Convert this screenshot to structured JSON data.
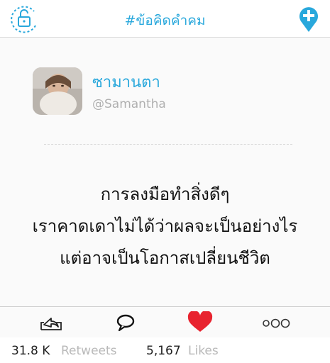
{
  "header": {
    "title": "#ข้อคิดคำคม",
    "lock_icon": "lock-icon",
    "add_icon": "add-location-icon",
    "accent_color": "#29a8dc"
  },
  "profile": {
    "display_name": "ซามานตา",
    "handle": "@Samantha"
  },
  "quote": {
    "lines": [
      "การลงมือทำสิ่งดีๆ",
      "เราคาดเดาไม่ได้ว่าผลจะเป็นอย่างไร",
      "แต่อาจเป็นโอกาสเปลี่ยนชีวิต"
    ]
  },
  "actions": {
    "share_icon": "share-icon",
    "comment_icon": "comment-icon",
    "like_icon": "heart-icon",
    "more_icon": "more-icon",
    "like_color": "#e8232f"
  },
  "stats": {
    "retweets_count": "31.8 K",
    "retweets_label": "Retweets",
    "likes_count": "5,167",
    "likes_label": "Likes"
  }
}
